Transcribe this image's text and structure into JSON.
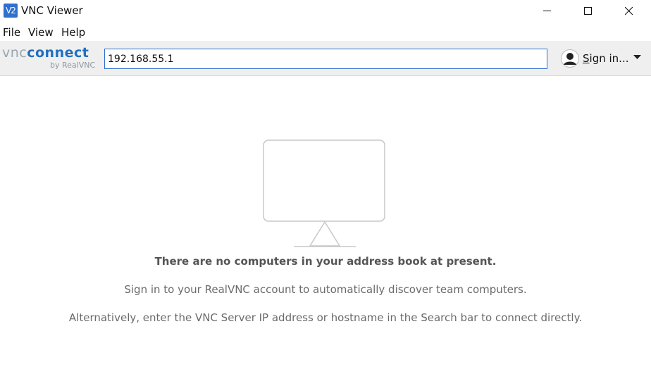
{
  "window": {
    "app_icon_text": "V2",
    "title": "VNC Viewer"
  },
  "menu": {
    "items": [
      "File",
      "View",
      "Help"
    ]
  },
  "toolbar": {
    "logo_vnc": "vnc",
    "logo_connect": "connect",
    "logo_sub": "by RealVNC",
    "search_value": "192.168.55.1",
    "signin_label": "Sign in..."
  },
  "main": {
    "empty_title": "There are no computers in your address book at present.",
    "line1": "Sign in to your RealVNC account to automatically discover team computers.",
    "line2": "Alternatively, enter the VNC Server IP address or hostname in the Search bar to connect directly."
  },
  "colors": {
    "accent": "#2e6fd0",
    "toolbar_bg": "#efefef"
  }
}
